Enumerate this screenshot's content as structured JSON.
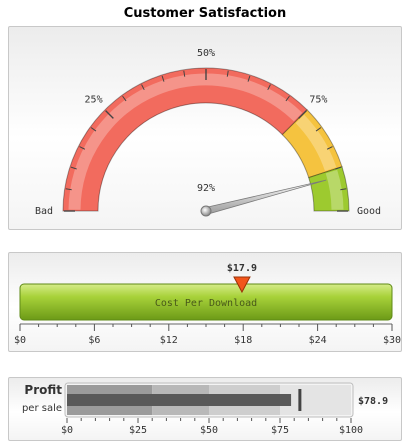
{
  "chart_data": [
    {
      "type": "angular-gauge",
      "title": "Customer Satisfaction",
      "lower_limit": 0,
      "upper_limit": 100,
      "value": 92,
      "value_label": "92%",
      "tick_labels": [
        "25%",
        "50%",
        "75%"
      ],
      "tick_values": [
        25,
        50,
        75
      ],
      "lower_label": "Bad",
      "upper_label": "Good",
      "color_ranges": [
        {
          "min": 0,
          "max": 75,
          "color": "#f26b5e"
        },
        {
          "min": 75,
          "max": 90,
          "color": "#f5c33f"
        },
        {
          "min": 90,
          "max": 100,
          "color": "#9dca2f"
        }
      ]
    },
    {
      "type": "horizontal-linear-gauge",
      "title": "Cost Per Download",
      "lower_limit": 0,
      "upper_limit": 30,
      "value": 17.9,
      "value_label": "$17.9",
      "tick_labels": [
        "$0",
        "$6",
        "$12",
        "$18",
        "$24",
        "$30"
      ],
      "tick_values": [
        0,
        6,
        12,
        18,
        24,
        30
      ],
      "bar_color": "#8fc02c",
      "pointer_color": "#f2551b"
    },
    {
      "type": "bullet",
      "title": "Profit",
      "subtitle": "per sale",
      "lower_limit": 0,
      "upper_limit": 100,
      "value": 78.9,
      "value_label": "$78.9",
      "target": 82,
      "tick_labels": [
        "$0",
        "$25",
        "$50",
        "$75",
        "$100"
      ],
      "tick_values": [
        0,
        25,
        50,
        75,
        100
      ],
      "bands": [
        {
          "min": 0,
          "max": 30,
          "color": "#9b9b9b"
        },
        {
          "min": 30,
          "max": 50,
          "color": "#b8b8b8"
        },
        {
          "min": 50,
          "max": 75,
          "color": "#cecece"
        },
        {
          "min": 75,
          "max": 100,
          "color": "#e4e4e4"
        }
      ],
      "bar_color": "#595959",
      "target_color": "#444444"
    }
  ]
}
